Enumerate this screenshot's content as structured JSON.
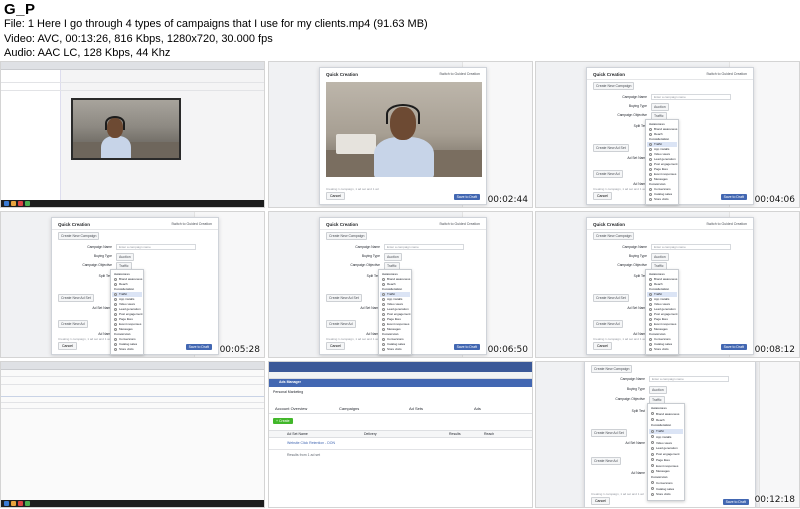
{
  "header": {
    "brand": "G_P",
    "file_line": "File: 1  Here I go through 4 types of campaigns that I use for my clients.mp4 (91.63 MB)",
    "video_line": "Video: AVC, 00:13:26, 816 Kbps, 1280x720, 30.000 fps",
    "audio_line": "Audio: AAC LC, 128 Kbps, 44 Khz"
  },
  "thumbnails": [
    {
      "timestamp": ""
    },
    {
      "timestamp": "00:02:44"
    },
    {
      "timestamp": "00:04:06"
    },
    {
      "timestamp": "00:05:28"
    },
    {
      "timestamp": "00:06:50"
    },
    {
      "timestamp": "00:08:12"
    },
    {
      "timestamp": ""
    },
    {
      "timestamp": ""
    },
    {
      "timestamp": "00:12:18"
    }
  ],
  "modal": {
    "title": "Quick Creation",
    "switch_link": "Switch to Guided Creation",
    "create_campaign": "Create New Campaign",
    "campaign_name_label": "Campaign Name",
    "campaign_name_placeholder": "Enter a campaign name",
    "buying_type_label": "Buying Type",
    "buying_type_value": "Auction",
    "objective_label": "Campaign Objective",
    "objective_value": "Traffic",
    "split_test_label": "Split Test",
    "create_adset": "Create New Ad Set",
    "adset_name_label": "Ad Set Name",
    "create_ad": "Create New Ad",
    "ad_name_label": "Ad Name",
    "footer_text": "Creating 1 campaign, 1 ad set and 1 ad",
    "cancel": "Cancel",
    "save": "Save to Draft"
  },
  "dropdown": {
    "sections": [
      {
        "title": "Awareness",
        "items": [
          "Brand awareness",
          "Reach"
        ]
      },
      {
        "title": "Consideration",
        "items": [
          "Traffic",
          "App installs",
          "Video views",
          "Lead generation",
          "Post engagement",
          "Page likes",
          "Event responses",
          "Messages"
        ]
      },
      {
        "title": "Conversion",
        "items": [
          "Conversions",
          "Catalog sales",
          "Store visits"
        ]
      }
    ],
    "selected": "Traffic"
  },
  "ads_manager": {
    "app_title": "Ads Manager",
    "account": "Personal Marketing",
    "tab_overview": "Account Overview",
    "tab_campaigns": "Campaigns",
    "tab_adsets": "Ad Sets",
    "tab_ads": "Ads",
    "create_button": "+ Create",
    "col_adsets": "Ad Set Name",
    "col_delivery": "Delivery",
    "col_results": "Results",
    "col_reach": "Reach",
    "row_name": "Website Click Retention - DON",
    "row_footer": "Results from 1 ad set"
  },
  "colors": {
    "fb_blue": "#4267b2",
    "fb_dark": "#3b5998",
    "green": "#42b72a"
  }
}
